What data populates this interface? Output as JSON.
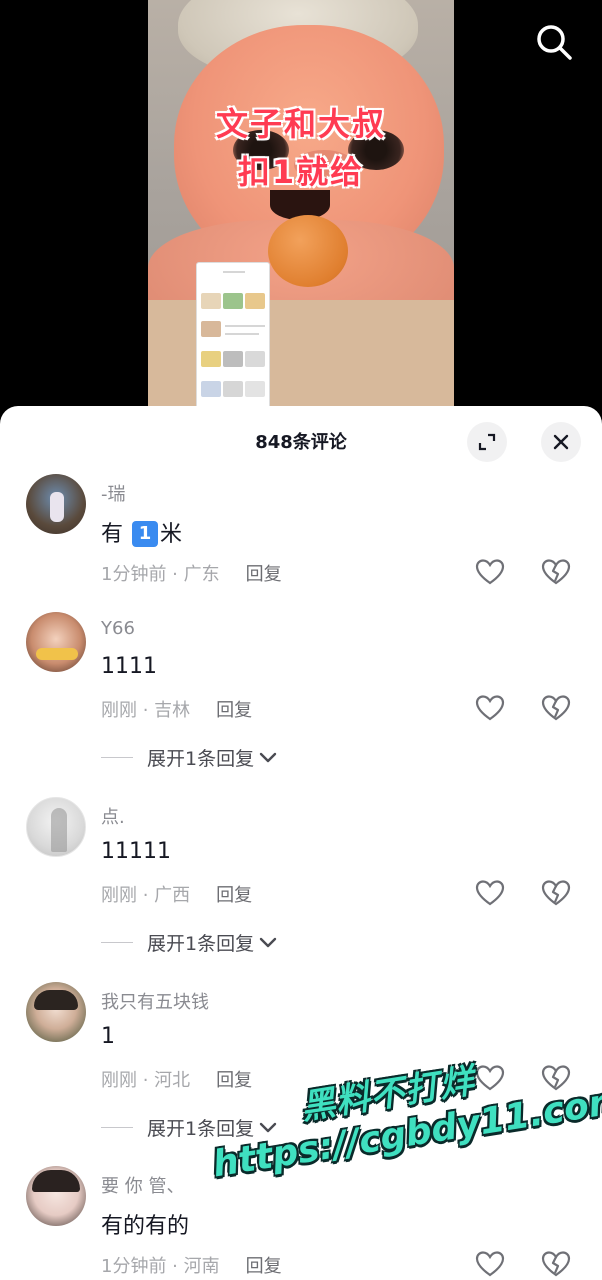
{
  "video": {
    "caption_line1": "文子和大叔",
    "caption_line2": "扣1就给"
  },
  "sheet": {
    "title": "848条评论"
  },
  "comments": [
    {
      "username": "-瑞",
      "text_prefix": "有 ",
      "text_emoji": "1",
      "text_suffix": "米",
      "time_location": "1分钟前 · 广东",
      "reply_label": "回复"
    },
    {
      "username": "Y66",
      "text": "1111",
      "time_location": "刚刚 · 吉林",
      "reply_label": "回复",
      "expand_label": "展开1条回复"
    },
    {
      "username": "点.",
      "text": "11111",
      "time_location": "刚刚 · 广西",
      "reply_label": "回复",
      "expand_label": "展开1条回复"
    },
    {
      "username": "我只有五块钱",
      "text": "1",
      "time_location": "刚刚 · 河北",
      "reply_label": "回复",
      "expand_label": "展开1条回复"
    },
    {
      "username": "要 你 管、",
      "text": "有的有的",
      "time_location": "1分钟前 · 河南",
      "reply_label": "回复"
    }
  ],
  "watermark": {
    "line1": "黑料不打烊",
    "line2": "https://cgbdy11.com"
  },
  "colors": {
    "accent_caption": "#ff3b52",
    "watermark": "#3fe0c0"
  }
}
